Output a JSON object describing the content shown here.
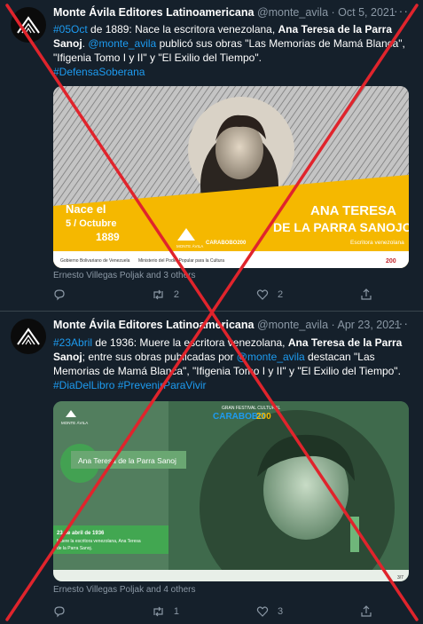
{
  "tweets": [
    {
      "author_name": "Monte Ávila Editores Latinoamericana",
      "handle": "@monte_avila",
      "date": "Oct 5, 2021",
      "text": {
        "hashtag_date": "#05Oct",
        "t1": " de 1889: Nace la escritora venezolana, ",
        "bold_name": "Ana Teresa de la Parra Sanoj",
        "t2": ". ",
        "mention": "@monte_avila",
        "t3": " publicó sus obras \"Las Memorias de Mamá Blanca\", \"Ifigenia Tomo I y II\" y \"El Exilio del Tiempo\".",
        "hashtag_1": "#DefensaSoberana"
      },
      "media": {
        "birth_label_1": "Nace el",
        "birth_label_2": "5 / Octubre",
        "birth_label_3": "1889",
        "name_line_1": "ANA TERESA",
        "name_line_2": "DE LA PARRA SANOJO",
        "caption": "Escritora venezolana",
        "publisher_logo": "MONTE ÁVILA",
        "footer_left": "Gobierno Bolivariano de Venezuela",
        "footer_mid": "Ministerio del Poder Popular para la Cultura",
        "festival": "CARABOBO200",
        "badge": "200"
      },
      "tagged": "Ernesto Villegas Poljak and 3 others",
      "replies": "",
      "retweets": "2",
      "likes": "2"
    },
    {
      "author_name": "Monte Ávila Editores Latinoamericana",
      "handle": "@monte_avila",
      "date": "Apr 23, 2021",
      "text": {
        "hashtag_date": "#23Abril",
        "t1": " de 1936: Muere la escritora venezolana, ",
        "bold_name": "Ana Teresa de la Parra Sanoj",
        "t2": "; entre sus obras publicadas por ",
        "mention": "@monte_avila",
        "t3": " destacan \"Las Memorias de Mamá Blanca\", \"Ifigenia Tomo I y II\" y \"El Exilio del Tiempo\".",
        "hashtag_1": "#DiaDelLibro",
        "hashtag_2": "#PrevenirParaVivir"
      },
      "media": {
        "festival_title": "GRAN FESTIVAL CULTURAL",
        "festival_name": "CARABOBO",
        "festival_num": "200",
        "name_box": "Ana Teresa de la Parra Sanoj",
        "date_box_1": "23 de abril de 1936",
        "date_box_2": "Muere la escritora venezolana, Ana Teresa",
        "date_box_3": "de la Parra Sanoj.",
        "publisher_logo": "MONTE ÁVILA",
        "badge": "3/7"
      },
      "tagged": "Ernesto Villegas Poljak and 4 others",
      "replies": "",
      "retweets": "1",
      "likes": "3"
    }
  ],
  "icons": [
    "reply-icon",
    "retweet-icon",
    "like-icon",
    "share-icon",
    "more-icon",
    "avatar-logo-icon"
  ],
  "colors": {
    "background": "#15202b",
    "link": "#1d9bf0",
    "muted": "#8b98a5",
    "cross": "#e0242c",
    "banner_yellow": "#f5b800",
    "media2_green": "#4f7a5a"
  }
}
